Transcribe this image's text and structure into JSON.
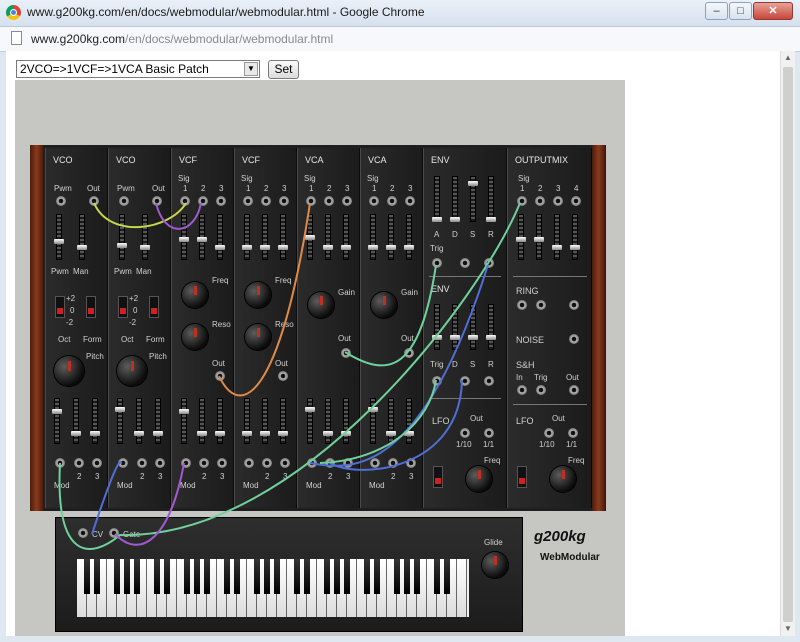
{
  "window": {
    "title": "www.g200kg.com/en/docs/webmodular/webmodular.html - Google Chrome"
  },
  "address": {
    "host": "www.g200kg.com",
    "path": "/en/docs/webmodular/webmodular.html"
  },
  "toolbar": {
    "patch_selected": "2VCO=>1VCF=>1VCA Basic Patch",
    "set_label": "Set"
  },
  "modules": {
    "vco1": {
      "title": "VCO",
      "pwm": "Pwm",
      "out": "Out",
      "pwm2": "Pwm",
      "man": "Man",
      "oct": "Oct",
      "form": "Form",
      "pitch": "Pitch",
      "mod": "Mod",
      "n2": "2",
      "n3": "3",
      "oct_p2": "+2",
      "oct_0": "0",
      "oct_m2": "-2"
    },
    "vco2": {
      "title": "VCO",
      "pwm": "Pwm",
      "out": "Out",
      "pwm2": "Pwm",
      "man": "Man",
      "oct": "Oct",
      "form": "Form",
      "pitch": "Pitch",
      "mod": "Mod",
      "n2": "2",
      "n3": "3",
      "oct_p2": "+2",
      "oct_0": "0",
      "oct_m2": "-2"
    },
    "vcf1": {
      "title": "VCF",
      "sig": "Sig",
      "n1": "1",
      "n2": "2",
      "n3": "3",
      "freq": "Freq",
      "reso": "Reso",
      "out": "Out",
      "mod": "Mod"
    },
    "vcf2": {
      "title": "VCF",
      "sig": "Sig",
      "n1": "1",
      "n2": "2",
      "n3": "3",
      "freq": "Freq",
      "reso": "Reso",
      "out": "Out",
      "mod": "Mod"
    },
    "vca1": {
      "title": "VCA",
      "sig": "Sig",
      "n1": "1",
      "n2": "2",
      "n3": "3",
      "gain": "Gain",
      "out": "Out",
      "mod": "Mod"
    },
    "vca2": {
      "title": "VCA",
      "sig": "Sig",
      "n1": "1",
      "n2": "2",
      "n3": "3",
      "gain": "Gain",
      "out": "Out",
      "mod": "Mod"
    },
    "env": {
      "title1": "ENV",
      "title2": "ENV",
      "a": "A",
      "d": "D",
      "s": "S",
      "r": "R",
      "trig": "Trig",
      "lfo": "LFO",
      "lfo_out": "Out",
      "r110": "1/10",
      "r11": "1/1",
      "freq": "Freq"
    },
    "outputmix": {
      "title": "OUTPUTMIX",
      "sig": "Sig",
      "n1": "1",
      "n2": "2",
      "n3": "3",
      "n4": "4",
      "ring": "RING",
      "noise": "NOISE",
      "sh": "S&H",
      "in": "In",
      "trig": "Trig",
      "out": "Out",
      "lfo": "LFO",
      "lfo_out": "Out",
      "r110": "1/10",
      "r11": "1/1",
      "freq": "Freq"
    }
  },
  "keyboard": {
    "cv": "CV",
    "gate": "Gate",
    "glide": "Glide"
  },
  "brand": {
    "logo": "g200kg",
    "sub": "WebModular"
  },
  "colors": {
    "cable_green": "#6fd19b",
    "cable_orange": "#e08a4a",
    "cable_blue": "#4f6fd6",
    "cable_purple": "#a05ad0",
    "cable_yellow": "#c8d84a"
  }
}
